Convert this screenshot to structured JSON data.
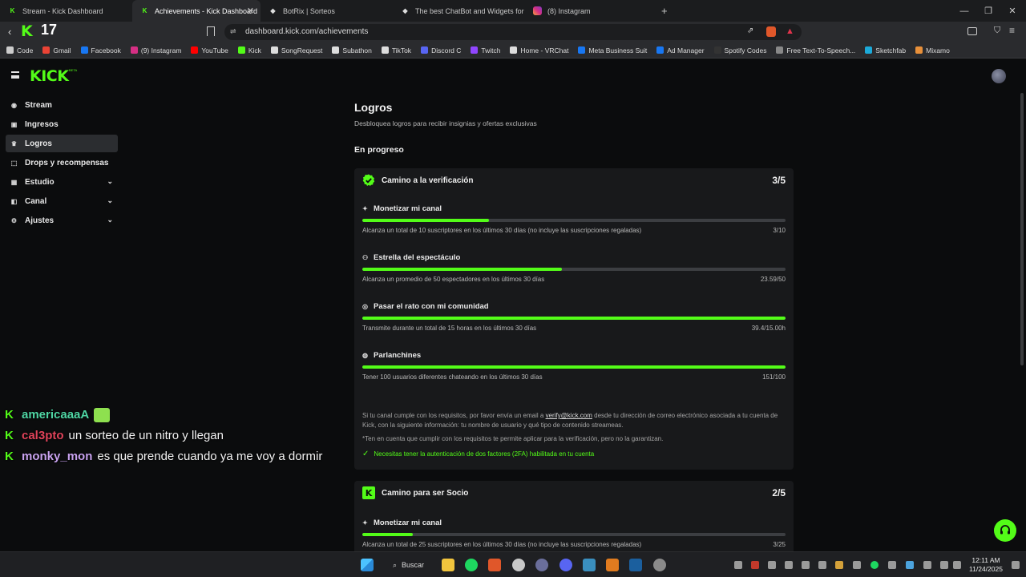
{
  "browser": {
    "tabs": [
      {
        "label": "Stream - Kick Dashboard",
        "active": false
      },
      {
        "label": "Achievements - Kick Dashboard",
        "active": true
      },
      {
        "label": "BotRix | Sorteos",
        "active": false
      },
      {
        "label": "The best ChatBot and Widgets for Kic",
        "active": false
      },
      {
        "label": "(8) Instagram",
        "active": false
      }
    ],
    "new_tab": "+",
    "url": "dashboard.kick.com/achievements",
    "viewer_count": "17",
    "bookmarks": [
      "Code",
      "Gmail",
      "Facebook",
      "(9) Instagram",
      "YouTube",
      "Kick",
      "SongRequest",
      "Subathon",
      "TikTok",
      "Discord C",
      "Twitch",
      "Home - VRChat",
      "Meta Business Suit",
      "Ad Manager",
      "Spotify Codes",
      "Free Text-To-Speech...",
      "Sketchfab",
      "Mixamo"
    ]
  },
  "kick": {
    "logo": "KICK",
    "logo_tag": "BETA",
    "sidebar": [
      {
        "label": "Stream",
        "icon": "broadcast-icon",
        "expandable": false,
        "active": false
      },
      {
        "label": "Ingresos",
        "icon": "wallet-icon",
        "expandable": false,
        "active": false
      },
      {
        "label": "Logros",
        "icon": "trophy-icon",
        "expandable": false,
        "active": true
      },
      {
        "label": "Drops y recompensas",
        "icon": "gift-icon",
        "expandable": false,
        "active": false
      },
      {
        "label": "Estudio",
        "icon": "studio-icon",
        "expandable": true,
        "active": false
      },
      {
        "label": "Canal",
        "icon": "channel-icon",
        "expandable": true,
        "active": false
      },
      {
        "label": "Ajustes",
        "icon": "gear-icon",
        "expandable": true,
        "active": false
      }
    ],
    "page_title": "Logros",
    "page_subtitle": "Desbloquea logros para recibir insignias y ofertas exclusivas",
    "section_in_progress": "En progreso",
    "cards": [
      {
        "title": "Camino a la verificación",
        "count": "3/5",
        "tasks": [
          {
            "name": "Monetizar mi canal",
            "desc": "Alcanza un total de 10 suscriptores en los últimos 30 días (no incluye las suscripciones regaladas)",
            "progress": "3/10",
            "fraction": 0.3
          },
          {
            "name": "Estrella del espectáculo",
            "desc": "Alcanza un promedio de 50 espectadores en los últimos 30 días",
            "progress": "23.59/50",
            "fraction": 0.4718
          },
          {
            "name": "Pasar el rato con mi comunidad",
            "desc": "Transmite durante un total de 15 horas en los últimos 30 días",
            "progress": "39.4/15.00h",
            "fraction": 1.0
          },
          {
            "name": "Parlanchines",
            "desc": "Tener 100 usuarios diferentes chateando en los últimos 30 días",
            "progress": "151/100",
            "fraction": 1.0
          }
        ],
        "note_before_link": "Si tu canal cumple con los requisitos, por favor envía un email a ",
        "note_link": "verify@kick.com",
        "note_after_link": " desde tu dirección de correo electrónico asociada a tu cuenta de Kick, con la siguiente información: tu nombre de usuario y qué tipo de contenido streameas.",
        "disclaimer": "*Ten en cuenta que cumplir con los requisitos te permite aplicar para la verificación, pero no la garantizan.",
        "requirement": "Necesitas tener la autenticación de dos factores (2FA) habilitada en tu cuenta"
      },
      {
        "title": "Camino para ser Socio",
        "count": "2/5",
        "tasks": [
          {
            "name": "Monetizar mi canal",
            "desc": "Alcanza un total de 25 suscriptores en los últimos 30 días (no incluye las suscripciones regaladas)",
            "progress": "3/25",
            "fraction": 0.12
          }
        ]
      }
    ]
  },
  "chat_overlay": [
    {
      "user": "americaaaA",
      "user_color": "#4fd6a4",
      "text": ""
    },
    {
      "user": "cal3pto",
      "user_color": "#e0435a",
      "text": "un sorteo de un nitro y llegan"
    },
    {
      "user": "monky_mon",
      "user_color": "#c9a3f0",
      "text": "es que prende cuando ya me voy a dormir"
    }
  ],
  "taskbar": {
    "search_label": "Buscar",
    "time": "12:11 AM",
    "date": "11/24/2025"
  },
  "colors": {
    "accent": "#53fc18",
    "bg": "#0b0c0d",
    "card": "#18191b"
  }
}
